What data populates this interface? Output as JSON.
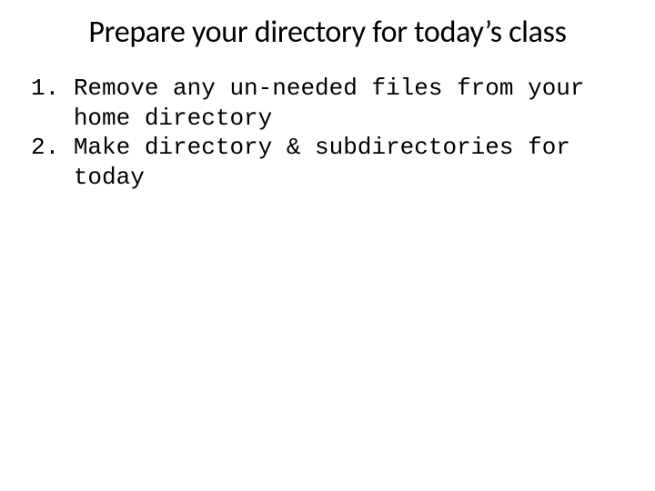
{
  "title": "Prepare your directory for today’s class",
  "items": [
    {
      "marker": "1. ",
      "text": "Remove any un-needed files from your home directory"
    },
    {
      "marker": "2. ",
      "text": "Make directory & subdirectories for today"
    }
  ]
}
